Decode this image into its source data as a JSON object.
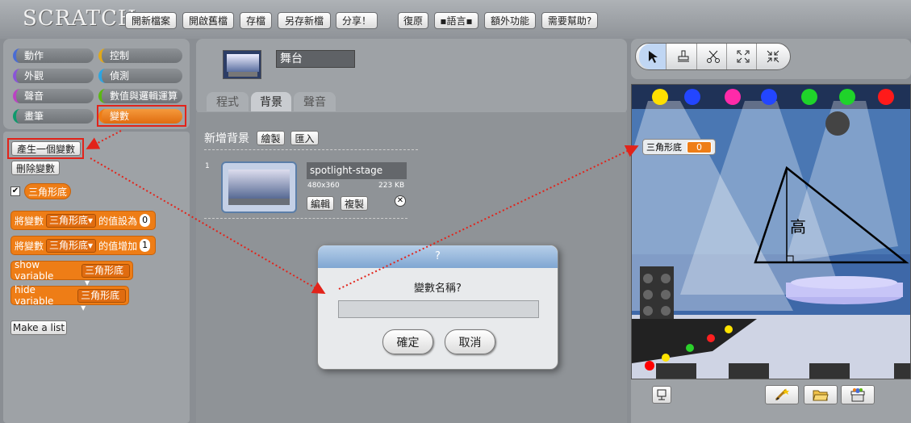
{
  "app": {
    "logo": "SCRATCH"
  },
  "menu": [
    {
      "label": "開新檔案"
    },
    {
      "label": "開啟舊檔"
    },
    {
      "label": "存檔"
    },
    {
      "label": "另存新檔"
    },
    {
      "label": "分享！"
    },
    {
      "label": "復原"
    },
    {
      "label": "▪語言▪"
    },
    {
      "label": "額外功能"
    },
    {
      "label": "需要幫助?"
    }
  ],
  "categories": [
    {
      "label": "動作",
      "color": "#4a6cd4"
    },
    {
      "label": "控制",
      "color": "#e1a91a"
    },
    {
      "label": "外觀",
      "color": "#8a55d7"
    },
    {
      "label": "偵測",
      "color": "#2ca5e2"
    },
    {
      "label": "聲音",
      "color": "#bb42c3"
    },
    {
      "label": "數值與邏輯運算",
      "color": "#5cb712"
    },
    {
      "label": "畫筆",
      "color": "#0e9a6c"
    },
    {
      "label": "變數",
      "color": "#ee7d16"
    }
  ],
  "palette": {
    "make_variable": "產生一個變數",
    "delete_variable": "刪除變數",
    "var_name": "三角形底",
    "set_prefix": "將變數",
    "set_suffix": "的值設為",
    "set_value": "0",
    "change_prefix": "將變數",
    "change_suffix": "的值增加",
    "change_value": "1",
    "show_var": "show variable",
    "hide_var": "hide variable",
    "make_list": "Make a list"
  },
  "sprite": {
    "name": "舞台"
  },
  "tabs": [
    {
      "label": "程式"
    },
    {
      "label": "背景"
    },
    {
      "label": "聲音"
    }
  ],
  "backgrounds": {
    "new_label": "新增背景",
    "paint_btn": "繪製",
    "import_btn": "匯入",
    "item": {
      "index": "1",
      "name": "spotlight-stage",
      "dims": "480x360",
      "size": "223 KB",
      "edit": "編輯",
      "copy": "複製"
    }
  },
  "dialog": {
    "title": "?",
    "prompt": "變數名稱?",
    "input_value": "",
    "ok": "確定",
    "cancel": "取消"
  },
  "stage": {
    "watcher_label": "三角形底",
    "watcher_value": "0",
    "height_label": "高"
  },
  "tools": [
    "cursor-icon",
    "stamp-icon",
    "scissors-icon",
    "grow-icon",
    "shrink-icon"
  ]
}
